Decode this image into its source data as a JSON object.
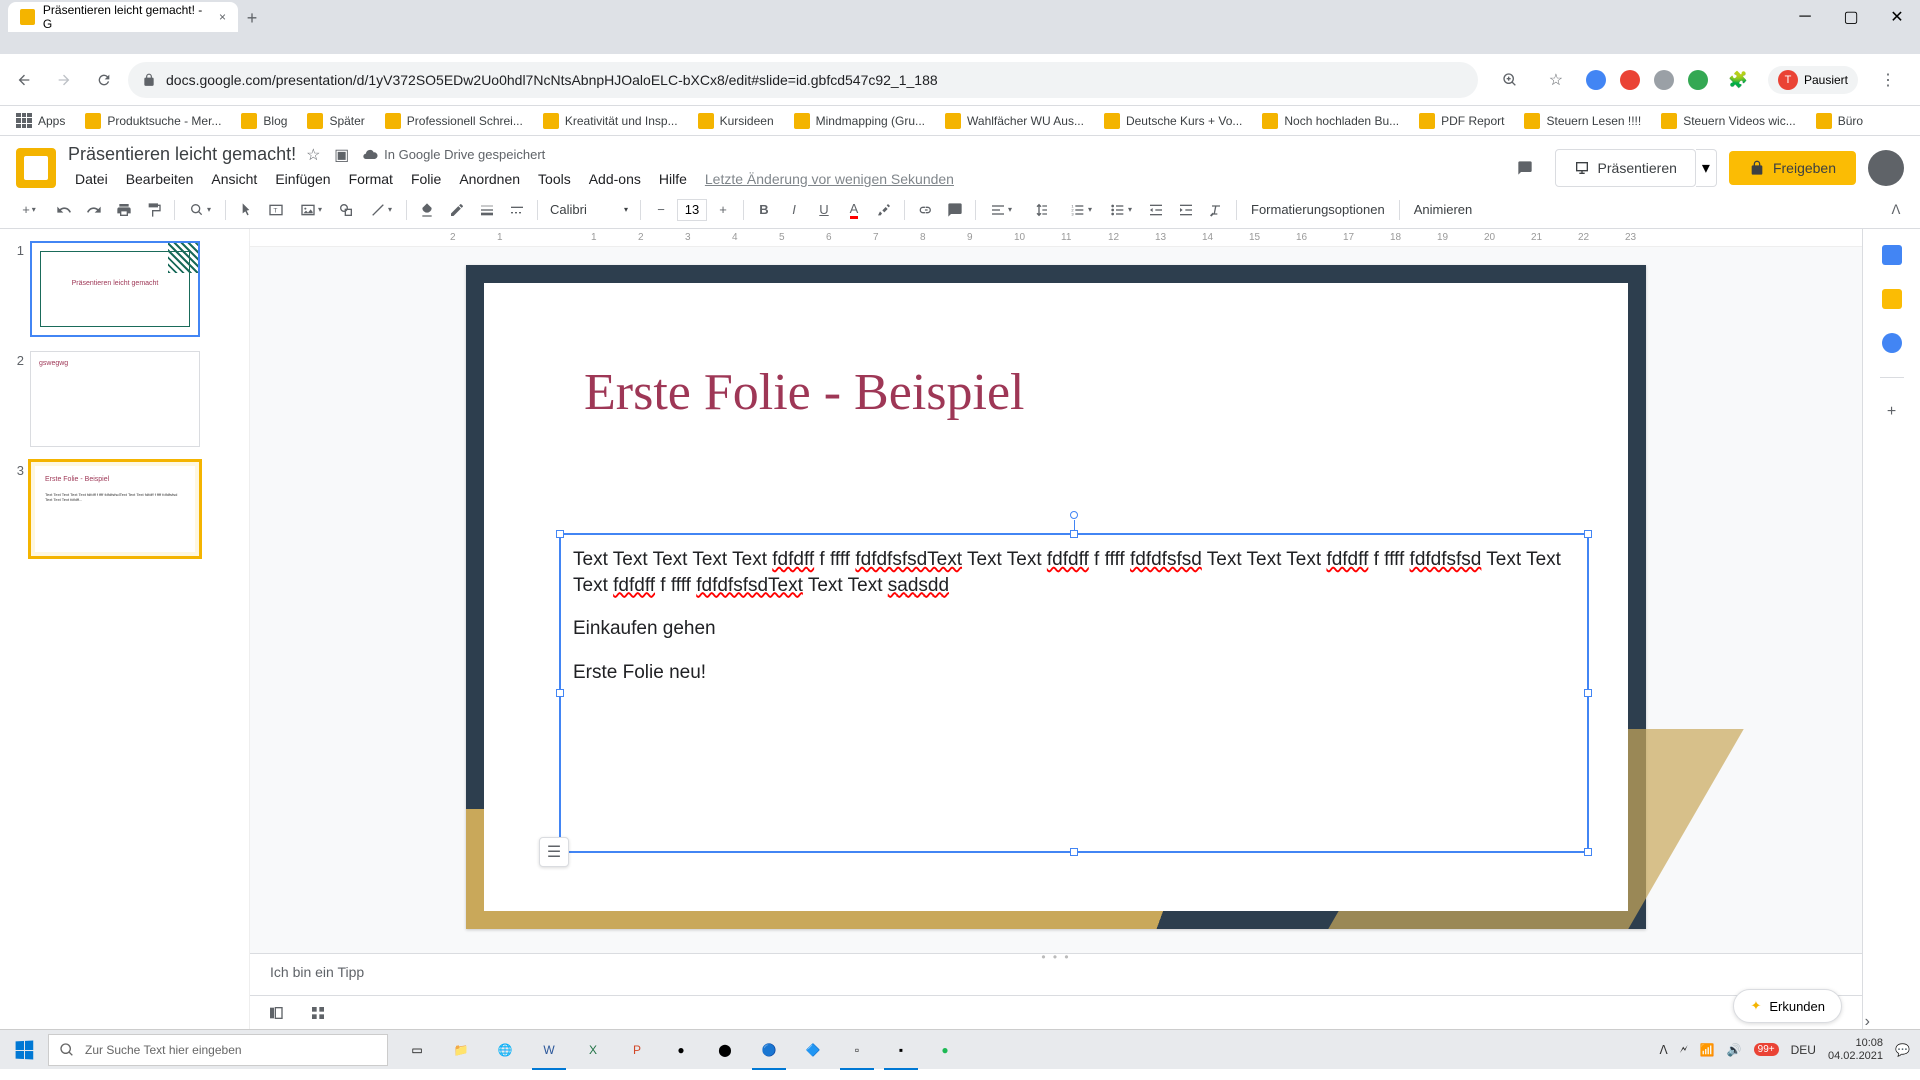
{
  "browser": {
    "tab_title": "Präsentieren leicht gemacht! - G",
    "url": "docs.google.com/presentation/d/1yV372SO5EDw2Uo0hdl7NcNtsAbnpHJOaloELC-bXCx8/edit#slide=id.gbfcd547c92_1_188",
    "pause_label": "Pausiert"
  },
  "bookmarks": [
    {
      "label": "Apps"
    },
    {
      "label": "Produktsuche - Mer..."
    },
    {
      "label": "Blog"
    },
    {
      "label": "Später"
    },
    {
      "label": "Professionell Schrei..."
    },
    {
      "label": "Kreativität und Insp..."
    },
    {
      "label": "Kursideen"
    },
    {
      "label": "Mindmapping  (Gru..."
    },
    {
      "label": "Wahlfächer WU Aus..."
    },
    {
      "label": "Deutsche Kurs + Vo..."
    },
    {
      "label": "Noch hochladen Bu..."
    },
    {
      "label": "PDF Report"
    },
    {
      "label": "Steuern Lesen !!!!"
    },
    {
      "label": "Steuern Videos wic..."
    },
    {
      "label": "Büro"
    }
  ],
  "doc": {
    "title": "Präsentieren leicht gemacht!",
    "save_status": "In Google Drive gespeichert",
    "last_change": "Letzte Änderung vor wenigen Sekunden"
  },
  "menu": [
    "Datei",
    "Bearbeiten",
    "Ansicht",
    "Einfügen",
    "Format",
    "Folie",
    "Anordnen",
    "Tools",
    "Add-ons",
    "Hilfe"
  ],
  "header_buttons": {
    "present": "Präsentieren",
    "share": "Freigeben"
  },
  "toolbar": {
    "font": "Calibri",
    "font_size": "13",
    "format_options": "Formatierungsoptionen",
    "animate": "Animieren"
  },
  "ruler_ticks": [
    "2",
    "1",
    "",
    "1",
    "2",
    "3",
    "4",
    "5",
    "6",
    "7",
    "8",
    "9",
    "10",
    "11",
    "12",
    "13",
    "14",
    "15",
    "16",
    "17",
    "18",
    "19",
    "20",
    "21",
    "22",
    "23"
  ],
  "slides": [
    {
      "num": "1",
      "preview_title": "Präsentieren leicht gemacht"
    },
    {
      "num": "2",
      "preview_title": "gswegwg"
    },
    {
      "num": "3",
      "preview_title": "Erste Folie - Beispiel"
    }
  ],
  "current_slide": {
    "title": "Erste Folie - Beispiel",
    "body_para1_parts": [
      {
        "t": "Text Text Text Text Text ",
        "s": false
      },
      {
        "t": "fdfdff",
        "s": true
      },
      {
        "t": " f ffff ",
        "s": false
      },
      {
        "t": "fdfdfsfsdText",
        "s": true
      },
      {
        "t": " Text Text ",
        "s": false
      },
      {
        "t": "fdfdff",
        "s": true
      },
      {
        "t": " f ffff ",
        "s": false
      },
      {
        "t": "fdfdfsfsd",
        "s": true
      },
      {
        "t": " Text Text Text ",
        "s": false
      },
      {
        "t": "fdfdff",
        "s": true
      },
      {
        "t": " f ffff ",
        "s": false
      },
      {
        "t": "fdfdfsfsd",
        "s": true
      },
      {
        "t": " Text Text Text ",
        "s": false
      },
      {
        "t": "fdfdff",
        "s": true
      },
      {
        "t": " f ffff ",
        "s": false
      },
      {
        "t": "fdfdfsfsdText",
        "s": true
      },
      {
        "t": " Text Text ",
        "s": false
      },
      {
        "t": "sadsdd",
        "s": true
      }
    ],
    "body_para2": "Einkaufen gehen",
    "body_para3": "Erste Folie neu!"
  },
  "speaker_notes": "Ich bin ein Tipp",
  "explore_label": "Erkunden",
  "taskbar": {
    "search_placeholder": "Zur Suche Text hier eingeben",
    "tray_count": "99+",
    "lang": "DEU",
    "time": "10:08",
    "date": "04.02.2021"
  }
}
